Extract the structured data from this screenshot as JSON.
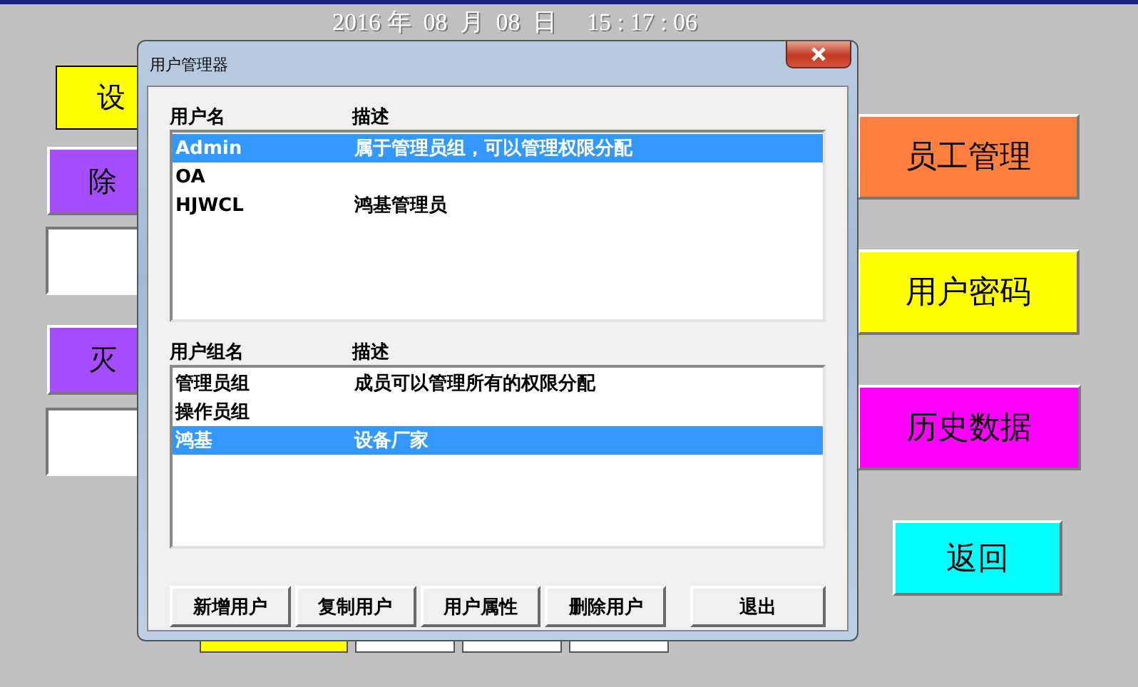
{
  "clock": "2016 年  08  月  08  日     15 : 17 : 06",
  "left_panel": [
    {
      "kind": "button",
      "label": "设",
      "color": "#ffff00"
    },
    {
      "kind": "button",
      "label": "除",
      "color": "#a64dff"
    },
    {
      "kind": "field"
    },
    {
      "kind": "button",
      "label": "灭",
      "color": "#a64dff"
    },
    {
      "kind": "field"
    }
  ],
  "right_panel": [
    {
      "label": "员工管理",
      "color": "#ff7f3f"
    },
    {
      "label": "用户密码",
      "color": "#ffff00"
    },
    {
      "label": "历史数据",
      "color": "#ff00ff"
    },
    {
      "label": "返回",
      "color": "#00ffff"
    }
  ],
  "bottom_bar": [
    {
      "color": "#ffff00"
    },
    {
      "color": "#ffffff"
    },
    {
      "color": "#ffffff"
    },
    {
      "color": "#ffffff"
    }
  ],
  "dialog": {
    "title": "用户管理器",
    "users": {
      "columns": [
        "用户名",
        "描述"
      ],
      "rows": [
        {
          "cells": [
            "Admin",
            "属于管理员组，可以管理权限分配"
          ],
          "selected": true
        },
        {
          "cells": [
            "OA",
            ""
          ],
          "selected": false
        },
        {
          "cells": [
            "HJWCL",
            "鸿基管理员"
          ],
          "selected": false
        }
      ]
    },
    "groups": {
      "columns": [
        "用户组名",
        "描述"
      ],
      "rows": [
        {
          "cells": [
            "管理员组",
            "成员可以管理所有的权限分配"
          ],
          "selected": false
        },
        {
          "cells": [
            "操作员组",
            ""
          ],
          "selected": false
        },
        {
          "cells": [
            "鸿基",
            "设备厂家"
          ],
          "selected": true
        }
      ]
    },
    "buttons": [
      "新增用户",
      "复制用户",
      "用户属性",
      "删除用户"
    ],
    "exit_button": "退出"
  }
}
